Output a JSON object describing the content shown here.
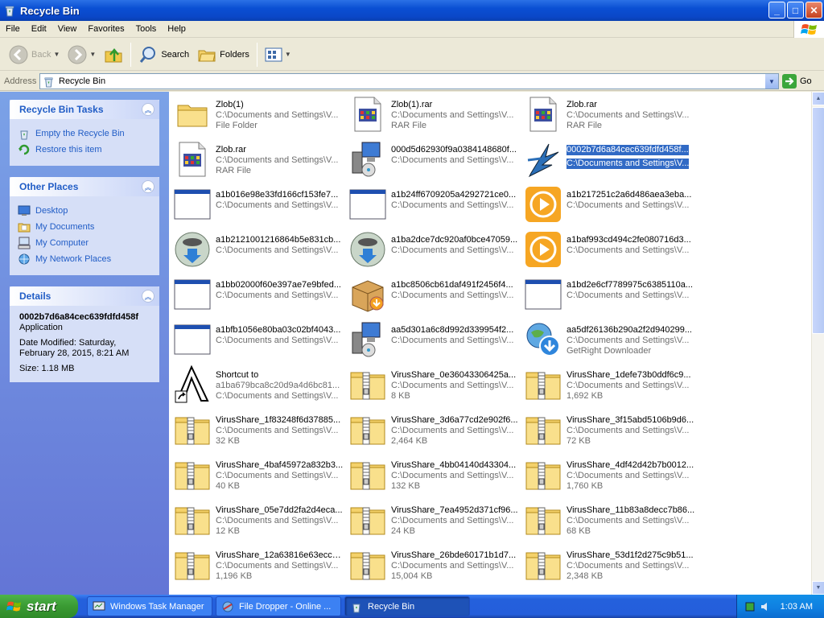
{
  "window": {
    "title": "Recycle Bin",
    "controls": {
      "minimize": "_",
      "maximize": "□",
      "close": "✕"
    }
  },
  "menu": [
    "File",
    "Edit",
    "View",
    "Favorites",
    "Tools",
    "Help"
  ],
  "toolbar": {
    "back": "Back",
    "search": "Search",
    "folders": "Folders"
  },
  "address": {
    "label": "Address",
    "value": "Recycle Bin",
    "go": "Go"
  },
  "left_pane": {
    "tasks": {
      "title": "Recycle Bin Tasks",
      "items": [
        "Empty the Recycle Bin",
        "Restore this item"
      ]
    },
    "places": {
      "title": "Other Places",
      "items": [
        "Desktop",
        "My Documents",
        "My Computer",
        "My Network Places"
      ]
    },
    "details": {
      "title": "Details",
      "name": "0002b7d6a84cec639fdfd458f",
      "type": "Application",
      "modified": "Date Modified: Saturday, February 28, 2015, 8:21 AM",
      "size": "Size: 1.18 MB"
    }
  },
  "files": [
    {
      "name": "Zlob(1)",
      "path": "C:\\Documents and Settings\\V...",
      "info": "File Folder",
      "icon": "folder-icon"
    },
    {
      "name": "Zlob(1).rar",
      "path": "C:\\Documents and Settings\\V...",
      "info": "RAR File",
      "icon": "rar-file-icon"
    },
    {
      "name": "Zlob.rar",
      "path": "C:\\Documents and Settings\\V...",
      "info": "RAR File",
      "icon": "rar-file-icon"
    },
    {
      "name": "Zlob.rar",
      "path": "C:\\Documents and Settings\\V...",
      "info": "RAR File",
      "icon": "rar-file-icon"
    },
    {
      "name": "000d5d62930f9a0384148680f...",
      "path": "C:\\Documents and Settings\\V...",
      "info": "",
      "icon": "installer-icon"
    },
    {
      "name": "0002b7d6a84cec639fdfd458f...",
      "path": "C:\\Documents and Settings\\V...",
      "info": "",
      "icon": "app-star-icon",
      "selected": true
    },
    {
      "name": "a1b016e98e33fd166cf153fe7...",
      "path": "C:\\Documents and Settings\\V...",
      "info": "",
      "icon": "window-app-icon"
    },
    {
      "name": "a1b24ff6709205a4292721ce0...",
      "path": "C:\\Documents and Settings\\V...",
      "info": "",
      "icon": "window-app-icon"
    },
    {
      "name": "a1b217251c2a6d486aea3eba...",
      "path": "C:\\Documents and Settings\\V...",
      "info": "",
      "icon": "media-player-icon"
    },
    {
      "name": "a1b2121001216864b5e831cb...",
      "path": "C:\\Documents and Settings\\V...",
      "info": "",
      "icon": "nsis-installer-icon"
    },
    {
      "name": "a1ba2dce7dc920af0bce47059...",
      "path": "C:\\Documents and Settings\\V...",
      "info": "",
      "icon": "nsis-installer-icon"
    },
    {
      "name": "a1baf993cd494c2fe080716d3...",
      "path": "C:\\Documents and Settings\\V...",
      "info": "",
      "icon": "media-player-icon"
    },
    {
      "name": "a1bb02000f60e397ae7e9bfed...",
      "path": "C:\\Documents and Settings\\V...",
      "info": "",
      "icon": "window-app-icon"
    },
    {
      "name": "a1bc8506cb61daf491f2456f4...",
      "path": "C:\\Documents and Settings\\V...",
      "info": "",
      "icon": "box-installer-icon"
    },
    {
      "name": "a1bd2e6cf7789975c6385110a...",
      "path": "C:\\Documents and Settings\\V...",
      "info": "",
      "icon": "window-app-icon"
    },
    {
      "name": "a1bfb1056e80ba03c02bf4043...",
      "path": "C:\\Documents and Settings\\V...",
      "info": "",
      "icon": "window-app-icon"
    },
    {
      "name": "aa5d301a6c8d992d339954f2...",
      "path": "C:\\Documents and Settings\\V...",
      "info": "",
      "icon": "installer-icon"
    },
    {
      "name": "aa5df26136b290a2f2d940299...",
      "path": "C:\\Documents and Settings\\V...",
      "info": "GetRight Downloader",
      "icon": "globe-download-icon"
    },
    {
      "name": "Shortcut to",
      "path": "a1ba679bca8c20d9a4d6bc81...",
      "info": "C:\\Documents and Settings\\V...",
      "icon": "shortcut-icon"
    },
    {
      "name": "VirusShare_0e36043306425a...",
      "path": "C:\\Documents and Settings\\V...",
      "info": "8 KB",
      "icon": "zip-folder-icon"
    },
    {
      "name": "VirusShare_1defe73b0ddf6c9...",
      "path": "C:\\Documents and Settings\\V...",
      "info": "1,692 KB",
      "icon": "zip-folder-icon"
    },
    {
      "name": "VirusShare_1f83248f6d37885...",
      "path": "C:\\Documents and Settings\\V...",
      "info": "32 KB",
      "icon": "zip-folder-icon"
    },
    {
      "name": "VirusShare_3d6a77cd2e902f6...",
      "path": "C:\\Documents and Settings\\V...",
      "info": "2,464 KB",
      "icon": "zip-folder-icon"
    },
    {
      "name": "VirusShare_3f15abd5106b9d6...",
      "path": "C:\\Documents and Settings\\V...",
      "info": "72 KB",
      "icon": "zip-folder-icon"
    },
    {
      "name": "VirusShare_4baf45972a832b3...",
      "path": "C:\\Documents and Settings\\V...",
      "info": "40 KB",
      "icon": "zip-folder-icon"
    },
    {
      "name": "VirusShare_4bb04140d43304...",
      "path": "C:\\Documents and Settings\\V...",
      "info": "132 KB",
      "icon": "zip-folder-icon"
    },
    {
      "name": "VirusShare_4df42d42b7b0012...",
      "path": "C:\\Documents and Settings\\V...",
      "info": "1,760 KB",
      "icon": "zip-folder-icon"
    },
    {
      "name": "VirusShare_05e7dd2fa2d4eca...",
      "path": "C:\\Documents and Settings\\V...",
      "info": "12 KB",
      "icon": "zip-folder-icon"
    },
    {
      "name": "VirusShare_7ea4952d371cf96...",
      "path": "C:\\Documents and Settings\\V...",
      "info": "24 KB",
      "icon": "zip-folder-icon"
    },
    {
      "name": "VirusShare_11b83a8decc7b86...",
      "path": "C:\\Documents and Settings\\V...",
      "info": "68 KB",
      "icon": "zip-folder-icon"
    },
    {
      "name": "VirusShare_12a63816e63ecc1...",
      "path": "C:\\Documents and Settings\\V...",
      "info": "1,196 KB",
      "icon": "zip-folder-icon"
    },
    {
      "name": "VirusShare_26bde60171b1d7...",
      "path": "C:\\Documents and Settings\\V...",
      "info": "15,004 KB",
      "icon": "zip-folder-icon"
    },
    {
      "name": "VirusShare_53d1f2d275c9b51...",
      "path": "C:\\Documents and Settings\\V...",
      "info": "2,348 KB",
      "icon": "zip-folder-icon"
    }
  ],
  "taskbar": {
    "start": "start",
    "buttons": [
      "Windows Task Manager",
      "File Dropper - Online ...",
      "Recycle Bin"
    ],
    "clock": "1:03 AM"
  },
  "colors": {
    "titlebar": "#0a4fd3",
    "selection": "#316ac5",
    "task_link": "#215dc6"
  }
}
